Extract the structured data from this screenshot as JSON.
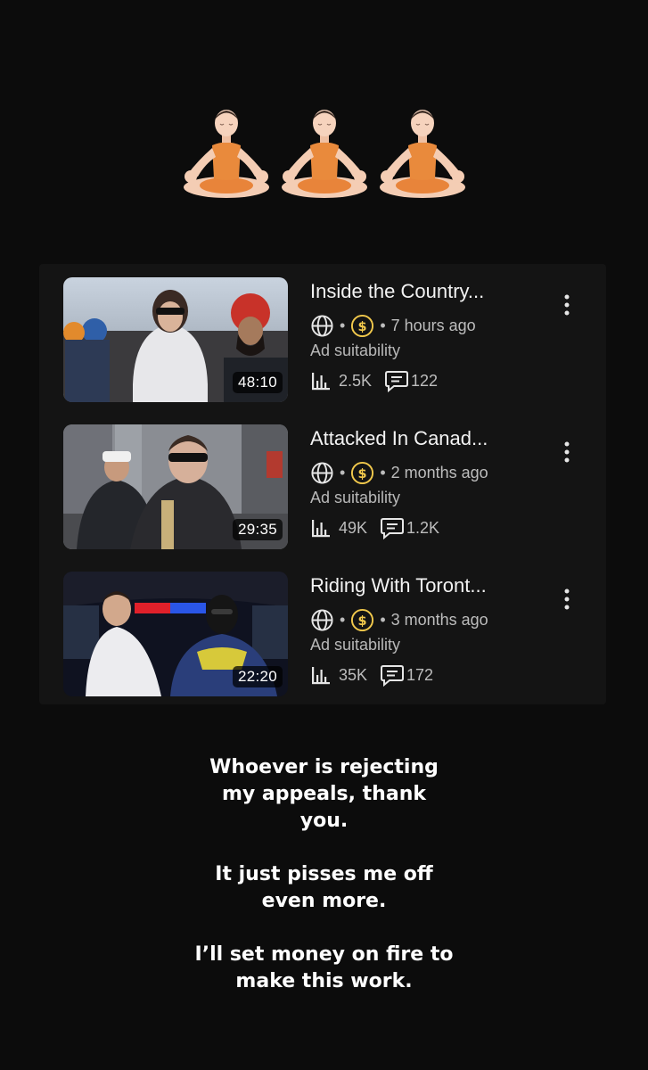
{
  "emoji": {
    "count": 3,
    "name": "person-in-lotus-position"
  },
  "videos": [
    {
      "title": "Inside the Country...",
      "age": "7 hours ago",
      "ad_label": "Ad suitability",
      "views": "2.5K",
      "comments": "122",
      "duration": "48:10"
    },
    {
      "title": "Attacked In Canad...",
      "age": "2 months ago",
      "ad_label": "Ad suitability",
      "views": "49K",
      "comments": "1.2K",
      "duration": "29:35"
    },
    {
      "title": "Riding With Toront...",
      "age": "3 months ago",
      "ad_label": "Ad suitability",
      "views": "35K",
      "comments": "172",
      "duration": "22:20"
    }
  ],
  "caption": {
    "line1": "Whoever is rejecting\nmy appeals, thank\nyou.",
    "line2": "It just pisses me off\neven more.",
    "line3": "I’ll set money on fire to\nmake this work."
  },
  "colors": {
    "background": "#0c0c0c",
    "panel": "#141414",
    "monetization": "#f2c94c"
  }
}
